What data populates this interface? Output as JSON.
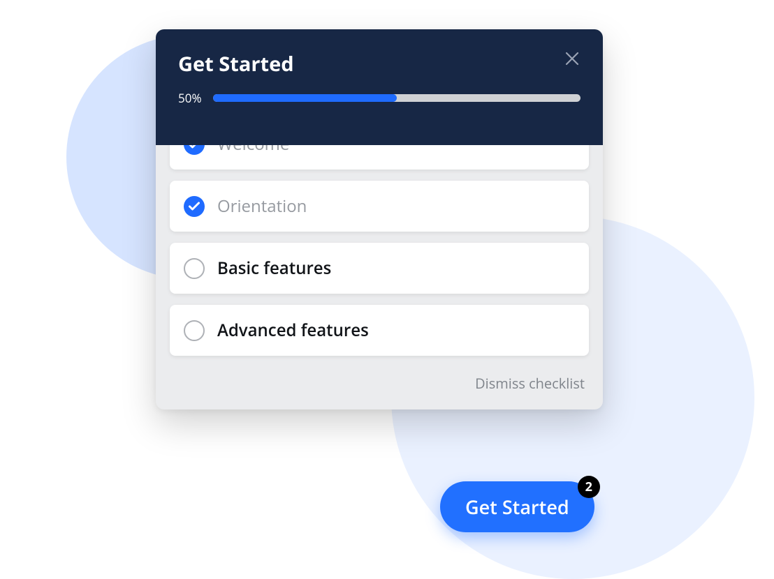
{
  "colors": {
    "header_bg": "#172745",
    "accent": "#1f6bff",
    "card_body": "#ebecee",
    "muted_text": "#969aa0",
    "dark_text": "#111418"
  },
  "header": {
    "title": "Get Started"
  },
  "progress": {
    "label": "50%",
    "percent": 50
  },
  "checklist": {
    "items": [
      {
        "label": "Welcome",
        "completed": true
      },
      {
        "label": "Orientation",
        "completed": true
      },
      {
        "label": "Basic features",
        "completed": false
      },
      {
        "label": "Advanced features",
        "completed": false
      }
    ],
    "dismiss_label": "Dismiss checklist"
  },
  "fab": {
    "label": "Get Started",
    "badge": "2"
  }
}
